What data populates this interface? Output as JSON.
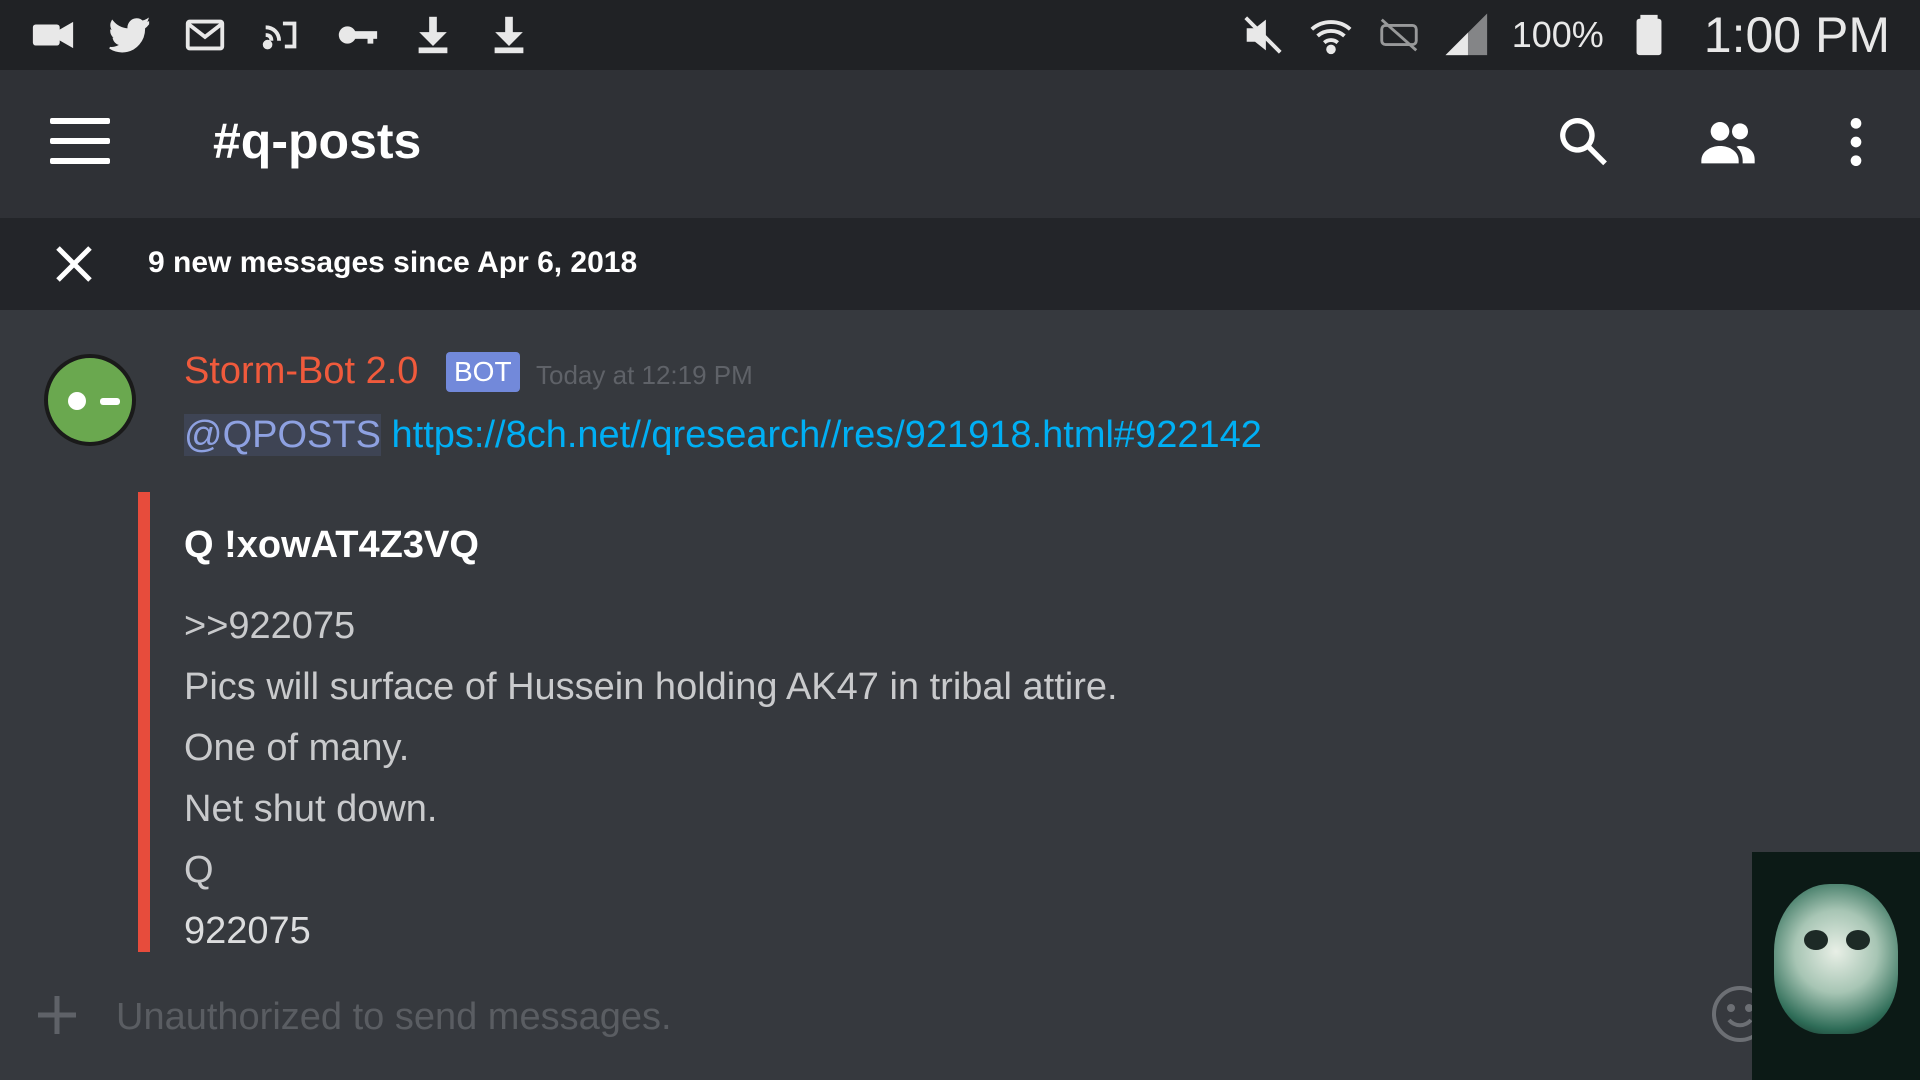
{
  "status_bar": {
    "battery_percent": "100%",
    "time": "1:00 PM",
    "left_icons": [
      "video-camera-icon",
      "twitter-icon",
      "gmail-icon",
      "cast-icon",
      "key-icon",
      "download-icon",
      "download-icon"
    ],
    "right_icons": [
      "mute-icon",
      "wifi-icon",
      "data-off-icon",
      "signal-icon",
      "battery-icon"
    ]
  },
  "header": {
    "channel_name": "#q-posts",
    "icons": [
      "menu-icon",
      "search-icon",
      "members-icon",
      "more-vertical-icon"
    ]
  },
  "new_messages_bar": {
    "text": "9 new messages since Apr 6, 2018"
  },
  "message": {
    "author": "Storm-Bot 2.0",
    "badge": "BOT",
    "timestamp": "Today at 12:19 PM",
    "mention": "@QPOSTS",
    "link": "https://8ch.net//qresearch//res/921918.html#922142",
    "embed": {
      "author": "Q !xowAT4Z3VQ",
      "lines": [
        ">>922075",
        "Pics will surface of Hussein holding AK47 in tribal attire.",
        "One of many.",
        "Net shut down.",
        "Q"
      ],
      "footer": "922075"
    }
  },
  "input": {
    "placeholder": "Unauthorized to send messages."
  },
  "colors": {
    "background": "#36393e",
    "header": "#2f3136",
    "author": "#f05a3c",
    "bot_badge": "#7289da",
    "link": "#00aff4",
    "embed_bar": "#e74c3c"
  }
}
